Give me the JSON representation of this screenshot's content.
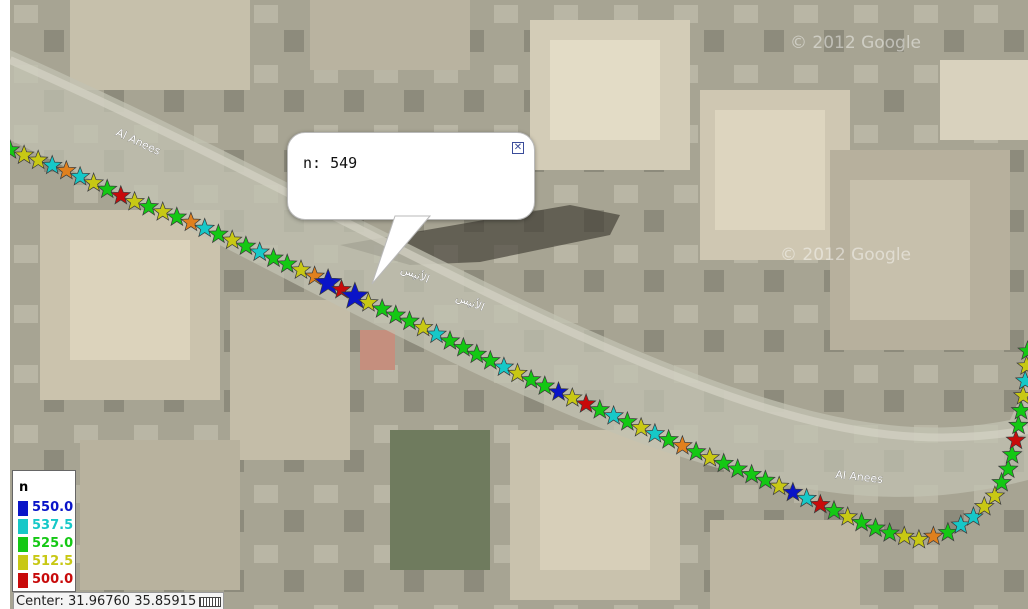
{
  "map": {
    "street_labels": [
      {
        "text": "Al Anees",
        "role": "street-label-northwest"
      },
      {
        "text": "الأنيس",
        "role": "street-label-arabic-1"
      },
      {
        "text": "الأنيس",
        "role": "street-label-arabic-2"
      },
      {
        "text": "Al Anees",
        "role": "street-label-east"
      }
    ],
    "watermarks": [
      "© 2012 Google",
      "© 2012 Google"
    ],
    "track_marker": "star-marker"
  },
  "popup": {
    "field": "n",
    "value": 549,
    "text": "n: 549",
    "close_icon": "close-icon",
    "close_glyph": "✕"
  },
  "legend": {
    "title": "n",
    "entries": [
      {
        "label": "550.0",
        "value": 550.0,
        "color": "#0a14c8"
      },
      {
        "label": "537.5",
        "value": 537.5,
        "color": "#16c8c8"
      },
      {
        "label": "525.0",
        "value": 525.0,
        "color": "#14c814"
      },
      {
        "label": "512.5",
        "value": 512.5,
        "color": "#c8c814"
      },
      {
        "label": "500.0",
        "value": 500.0,
        "color": "#c80a0a"
      }
    ]
  },
  "status_bar": {
    "text": "Center: 31.96760 35.85915",
    "center_lat": 31.9676,
    "center_lon": 35.85915,
    "scale_icon": "scale-icon"
  }
}
